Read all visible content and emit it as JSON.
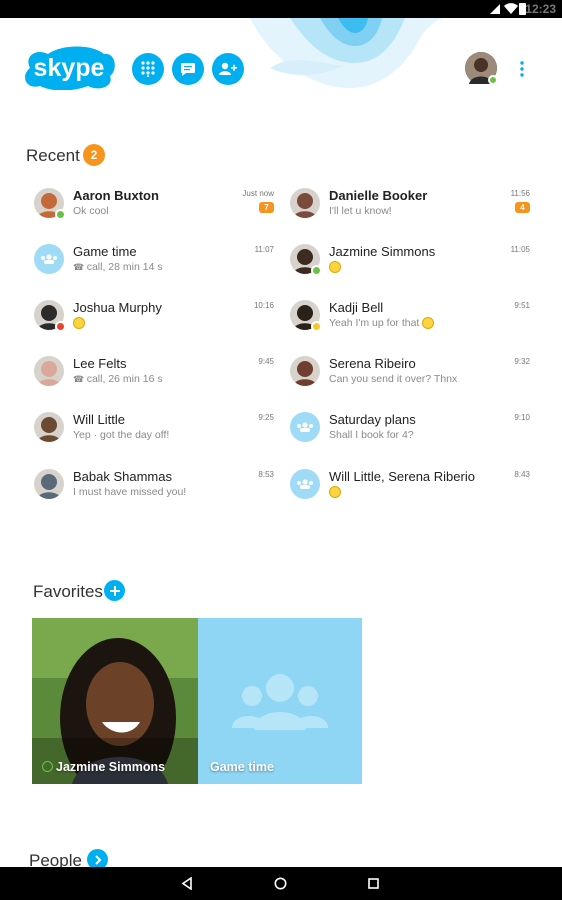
{
  "status_bar": {
    "time": "12:23"
  },
  "app": {
    "logo_text": "skype"
  },
  "header": {
    "buttons": [
      {
        "icon": "dialpad-icon"
      },
      {
        "icon": "chat-icon"
      },
      {
        "icon": "add-contact-icon"
      }
    ],
    "profile": {
      "status": "online"
    }
  },
  "recent": {
    "title": "Recent",
    "badge": "2",
    "left": [
      {
        "name": "Aaron Buxton",
        "sub": "Ok cool",
        "time": "Just now",
        "count": "7",
        "bold": true,
        "status": "online",
        "avatar_color": "#c46a3a"
      },
      {
        "name": "Game time",
        "sub": "call, 28 min 14 s",
        "time": "11:07",
        "group": true
      },
      {
        "name": "Joshua Murphy",
        "sub": "",
        "time": "10:16",
        "status": "busy",
        "avatar_color": "#2b2b2b",
        "emoji": true
      },
      {
        "name": "Lee Felts",
        "sub": "call, 26 min 16 s",
        "time": "9:45",
        "avatar_color": "#d9a89a"
      },
      {
        "name": "Will Little",
        "sub": "Yep · got the day off!",
        "time": "9:25",
        "avatar_color": "#6b4a32"
      },
      {
        "name": "Babak Shammas",
        "sub": "I must have missed you!",
        "time": "8:53",
        "avatar_color": "#5a6a78"
      }
    ],
    "right": [
      {
        "name": "Danielle Booker",
        "sub": "I'll let u know!",
        "time": "11:56",
        "count": "4",
        "bold": true,
        "avatar_color": "#7a4a3a"
      },
      {
        "name": "Jazmine Simmons",
        "sub": "",
        "time": "11:05",
        "status": "online",
        "avatar_color": "#3d2a20",
        "emoji": true
      },
      {
        "name": "Kadji Bell",
        "sub": "Yeah I'm up for that",
        "time": "9:51",
        "status": "away",
        "avatar_color": "#2a2218",
        "emoji": true
      },
      {
        "name": "Serena Ribeiro",
        "sub": "Can you send it over? Thnx",
        "time": "9:32",
        "avatar_color": "#6e3f30"
      },
      {
        "name": "Saturday plans",
        "sub": "Shall I book for 4?",
        "time": "9:10",
        "group": true
      },
      {
        "name": "Will Little, Serena Riberio",
        "sub": "",
        "time": "8:43",
        "group": true,
        "emoji": true
      }
    ]
  },
  "favorites": {
    "title": "Favorites",
    "items": [
      {
        "label": "Jazmine Simmons",
        "type": "person"
      },
      {
        "label": "Game time",
        "type": "group"
      }
    ]
  },
  "people": {
    "title": "People"
  },
  "colors": {
    "accent": "#00aff0",
    "badge": "#f7941d",
    "online": "#6cc04a",
    "busy": "#e6442e",
    "away": "#f8c72c"
  }
}
